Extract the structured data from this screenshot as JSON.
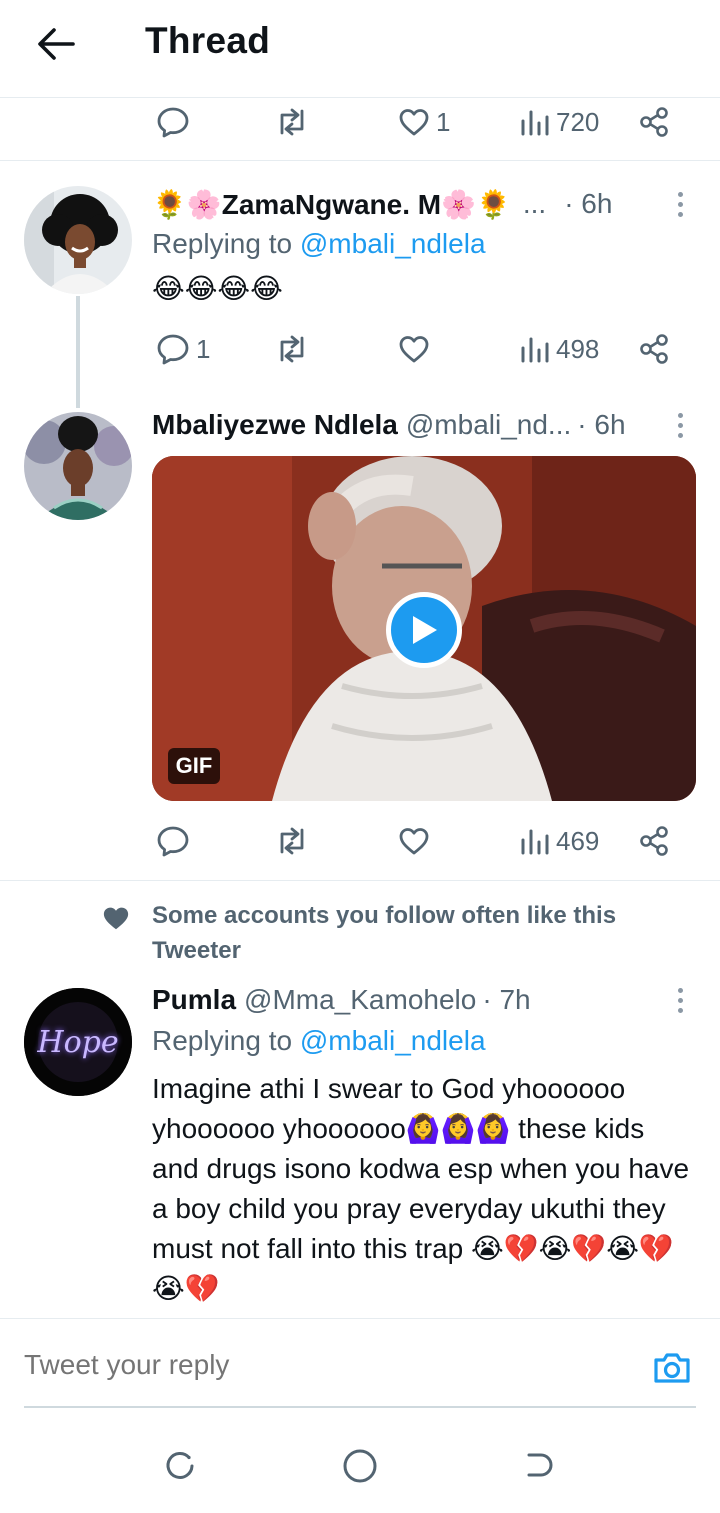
{
  "header": {
    "title": "Thread"
  },
  "top_actions": {
    "like_count": "1",
    "views_count": "720"
  },
  "tweets": [
    {
      "name": "🌻🌸ZamaNgwane. M🌸🌻",
      "ellipsis": "...",
      "time": "· 6h",
      "replying_prefix": "Replying to",
      "replying_to": "@mbali_ndlela",
      "text": "😂😂😂😂",
      "reply_count": "1",
      "views_count": "498"
    },
    {
      "name": "Mbaliyezwe Ndlela",
      "handle": "@mbali_nd...",
      "time": "· 6h",
      "media_badge": "GIF",
      "views_count": "469"
    },
    {
      "social_context": "Some accounts you follow often like this Tweeter",
      "name": "Pumla",
      "handle": "@Mma_Kamohelo",
      "time": "· 7h",
      "avatar_text": "Hope",
      "replying_prefix": "Replying to",
      "replying_to": "@mbali_ndlela",
      "text": "Imagine athi I swear to God yhoooooo yhoooooo yhoooooo🙆‍♀️🙆‍♀️🙆‍♀️ these kids and drugs isono kodwa esp when you have a boy child you pray everyday ukuthi they must not fall into this trap 😭💔😭💔😭💔😭💔"
    }
  ],
  "compose": {
    "placeholder": "Tweet your reply"
  },
  "colors": {
    "accent": "#1d9bf0",
    "muted": "#536471",
    "text": "#0f1419",
    "divider": "#e6ecf0"
  }
}
